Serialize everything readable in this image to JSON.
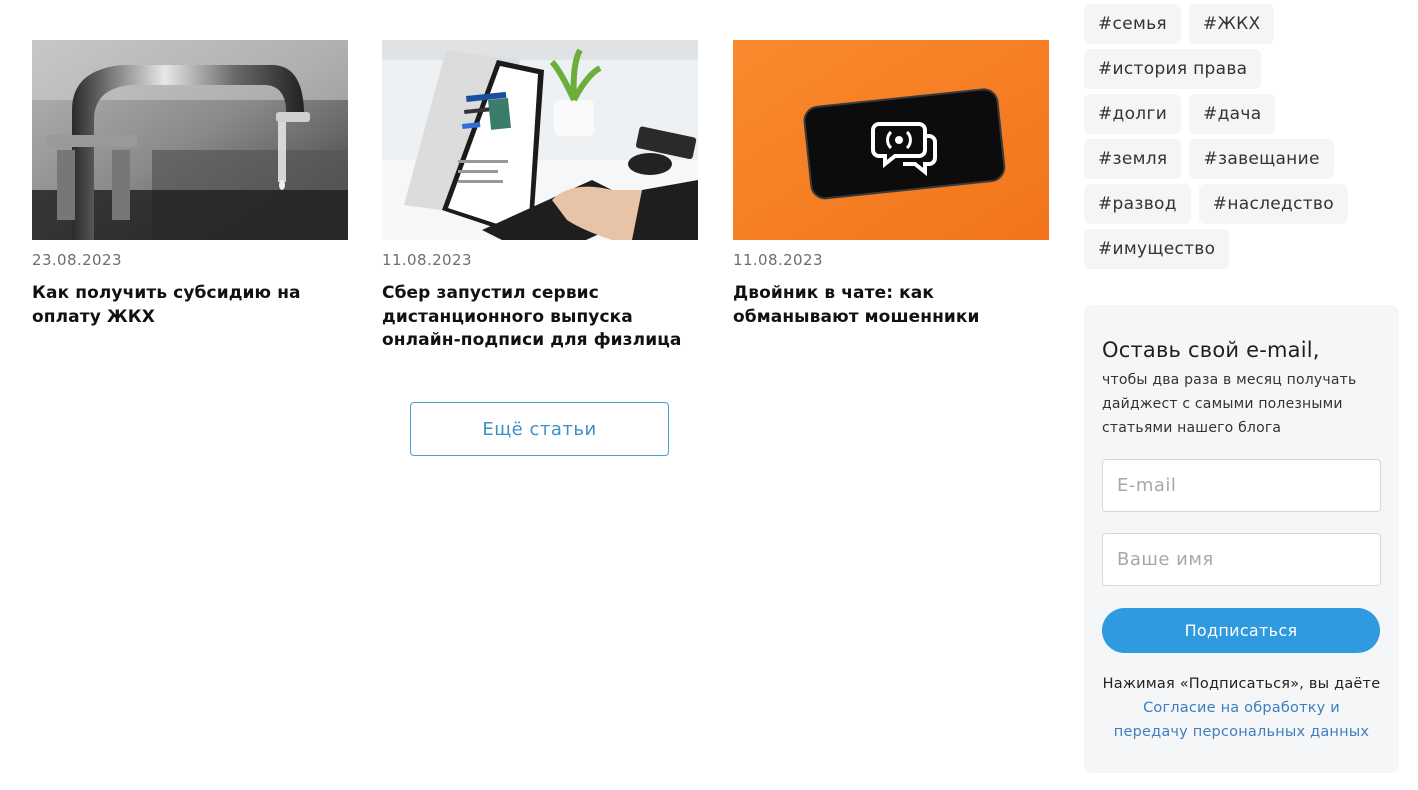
{
  "articles": [
    {
      "date": "23.08.2023",
      "title": "Как получить субсидию на оплату ЖКХ",
      "image": "faucet-water-drop-photo"
    },
    {
      "date": "11.08.2023",
      "title": "Сбер запустил сервис дистанционного выпуска онлайн-подписи для физлица",
      "image": "laptop-typing-photo"
    },
    {
      "date": "11.08.2023",
      "title": "Двойник в чате: как обманывают мошенники",
      "image": "smartphone-chat-icon-orange-photo"
    }
  ],
  "more_button": "Ещё статьи",
  "tags": [
    [
      "#семья",
      "#ЖКХ"
    ],
    [
      "#история права"
    ],
    [
      "#долги",
      "#дача"
    ],
    [
      "#земля",
      "#завещание"
    ],
    [
      "#развод",
      "#наследство"
    ],
    [
      "#имущество"
    ]
  ],
  "subscribe": {
    "title": "Оставь свой e-mail,",
    "description": "чтобы два раза в месяц получать дайджест с самыми полезными статьями нашего блога",
    "email_placeholder": "E-mail",
    "name_placeholder": "Ваше имя",
    "button": "Подписаться",
    "consent_text": "Нажимая «Подписаться», вы даёте",
    "consent_link": "Согласие на обработку и передачу персональных данных"
  },
  "colors": {
    "accent": "#2f9ae0",
    "link": "#3d7fc0",
    "tag_bg": "#f3f5f7",
    "panel_bg": "#f4f6f8",
    "orange": "#f47a20"
  }
}
